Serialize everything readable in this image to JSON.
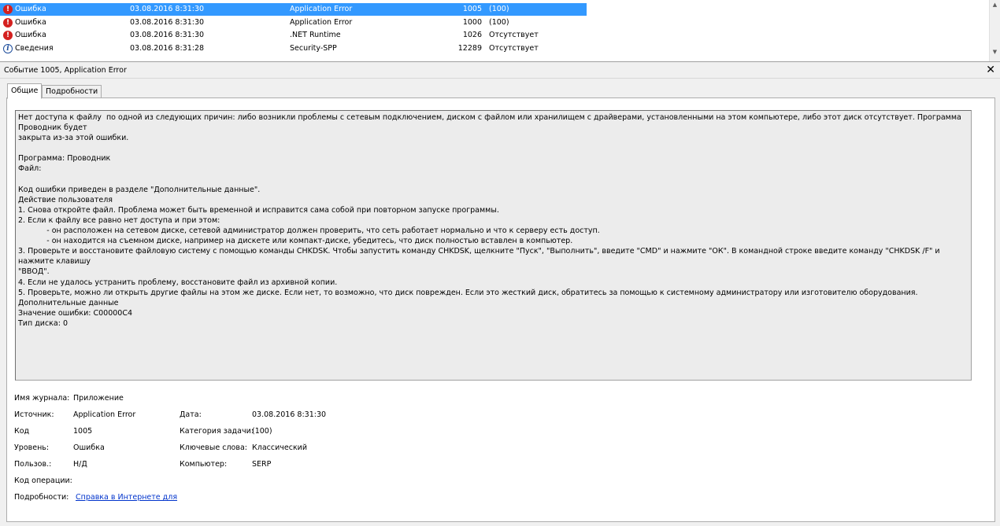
{
  "event_list": {
    "rows": [
      {
        "level": "Ошибка",
        "icon": "error-icon",
        "date": "03.08.2016 8:31:30",
        "source": "Application Error",
        "id": "1005",
        "category": "(100)",
        "selected": true
      },
      {
        "level": "Ошибка",
        "icon": "error-icon",
        "date": "03.08.2016 8:31:30",
        "source": "Application Error",
        "id": "1000",
        "category": "(100)",
        "selected": false
      },
      {
        "level": "Ошибка",
        "icon": "error-icon",
        "date": "03.08.2016 8:31:30",
        "source": ".NET Runtime",
        "id": "1026",
        "category": "Отсутствует",
        "selected": false
      },
      {
        "level": "Сведения",
        "icon": "info-icon",
        "date": "03.08.2016 8:31:28",
        "source": "Security-SPP",
        "id": "12289",
        "category": "Отсутствует",
        "selected": false
      }
    ]
  },
  "detail": {
    "title": "Событие 1005, Application Error",
    "close_glyph": "✕",
    "tabs": [
      "Общие",
      "Подробности"
    ],
    "description_lines": [
      "Нет доступа к файлу  по одной из следующих причин: либо возникли проблемы с сетевым подключением, диском с файлом или хранилищем с драйверами, установленными на этом компьютере, либо этот диск отсутствует. Программа Проводник будет",
      "закрыта из-за этой ошибки.",
      "",
      "Программа: Проводник",
      "Файл:",
      "",
      "Код ошибки приведен в разделе \"Дополнительные данные\".",
      "Действие пользователя",
      "1. Снова откройте файл. Проблема может быть временной и исправится сама собой при повторном запуске программы.",
      "2. Если к файлу все равно нет доступа и при этом:",
      "            - он расположен на сетевом диске, сетевой администратор должен проверить, что сеть работает нормально и что к серверу есть доступ.",
      "            - он находится на съемном диске, например на дискете или компакт-диске, убедитесь, что диск полностью вставлен в компьютер.",
      "3. Проверьте и восстановите файловую систему с помощью команды CHKDSK. Чтобы запустить команду CHKDSK, щелкните \"Пуск\", \"Выполнить\", введите \"CMD\" и нажмите \"ОК\". В командной строке введите команду \"CHKDSK /F\" и нажмите клавишу",
      "\"ВВОД\".",
      "4. Если не удалось устранить проблему, восстановите файл из архивной копии.",
      "5. Проверьте, можно ли открыть другие файлы на этом же диске. Если нет, то возможно, что диск поврежден. Если это жесткий диск, обратитесь за помощью к системному администратору или изготовителю оборудования.",
      "Дополнительные данные",
      "Значение ошибки: C00000C4",
      "Тип диска: 0"
    ],
    "properties": {
      "log_name_label": "Имя журнала:",
      "log_name_value": "Приложение",
      "source_label": "Источник:",
      "source_value": "Application Error",
      "date_label": "Дата:",
      "date_value": "03.08.2016 8:31:30",
      "code_label": "Код",
      "code_value": "1005",
      "task_category_label": "Категория задачи:",
      "task_category_value": "(100)",
      "level_label": "Уровень:",
      "level_value": "Ошибка",
      "keywords_label": "Ключевые слова:",
      "keywords_value": "Классический",
      "user_label": "Пользов.:",
      "user_value": "Н/Д",
      "computer_label": "Компьютер:",
      "computer_value": "SERP",
      "opcode_label": "Код операции:",
      "more_info_label": "Подробности:",
      "more_info_link": "Справка в Интернете для "
    }
  }
}
